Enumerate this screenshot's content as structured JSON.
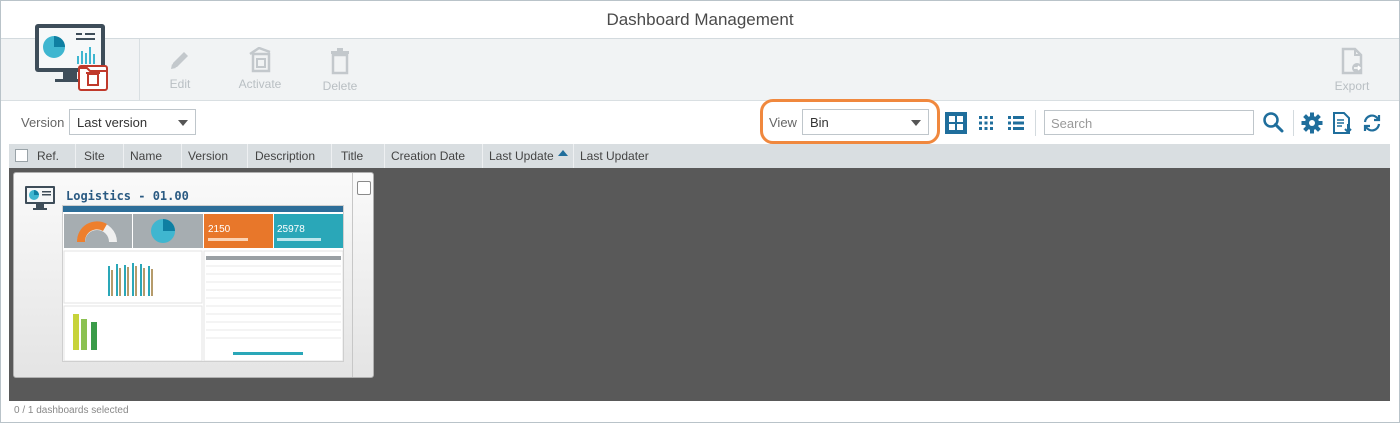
{
  "window": {
    "title": "Dashboard Management"
  },
  "toolbar": {
    "edit_label": "Edit",
    "activate_label": "Activate",
    "delete_label": "Delete",
    "export_label": "Export"
  },
  "filters": {
    "version_label": "Version",
    "version_value": "Last version",
    "view_label": "View",
    "view_value": "Bin",
    "search_placeholder": "Search"
  },
  "columns": [
    {
      "label": "Ref."
    },
    {
      "label": "Site"
    },
    {
      "label": "Name"
    },
    {
      "label": "Version"
    },
    {
      "label": "Description"
    },
    {
      "label": "Title"
    },
    {
      "label": "Creation Date"
    },
    {
      "label": "Last Update"
    },
    {
      "label": "Last Updater"
    }
  ],
  "sort": {
    "column": "Last Update",
    "direction": "ascending"
  },
  "dashboards": [
    {
      "title": "Logistics - 01.00",
      "thumbnail": {
        "kpi_1": "2150",
        "kpi_2": "25978"
      }
    }
  ],
  "status": {
    "selection_text": "0 / 1 dashboards selected"
  },
  "colors": {
    "accent": "#1f6e9c",
    "highlight": "#f0883e",
    "content_bg": "#595959"
  },
  "icons": {
    "app": "monitor-bin-icon",
    "edit": "pencil-icon",
    "activate": "activate-icon",
    "delete": "trash-icon",
    "export": "export-icon",
    "view_large": "grid-large-icon",
    "view_small": "grid-small-icon",
    "view_list": "list-icon",
    "search": "search-icon",
    "settings": "gear-icon",
    "report": "report-icon",
    "refresh": "refresh-icon"
  }
}
